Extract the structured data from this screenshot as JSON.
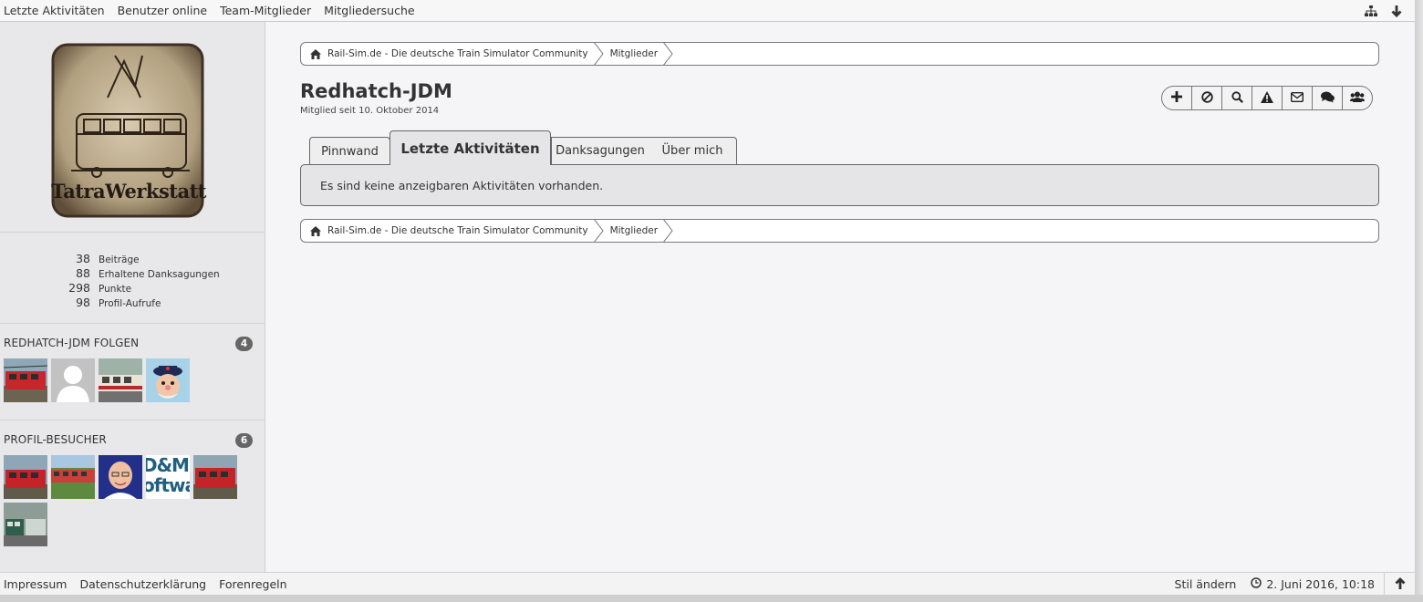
{
  "topbar": {
    "links": [
      "Letzte Aktivitäten",
      "Benutzer online",
      "Team-Mitglieder",
      "Mitgliedersuche"
    ],
    "icons": [
      "sitemap-icon",
      "arrow-down-icon"
    ]
  },
  "sidebar": {
    "avatar_text": "TatraWerkstatt",
    "stats": [
      {
        "value": "38",
        "label": "Beiträge"
      },
      {
        "value": "88",
        "label": "Erhaltene Danksagungen"
      },
      {
        "value": "298",
        "label": "Punkte"
      },
      {
        "value": "98",
        "label": "Profil-Aufrufe"
      }
    ],
    "following": {
      "heading": "REDHATCH-JDM FOLGEN",
      "count": "4"
    },
    "visitors": {
      "heading": "PROFIL-BESUCHER",
      "count": "6",
      "thumb_text": "D&M oftwar"
    }
  },
  "breadcrumb": {
    "home": "Rail-Sim.de - Die deutsche Train Simulator Community",
    "current": "Mitglieder"
  },
  "profile": {
    "name": "Redhatch-JDM",
    "member_since": "Mitglied seit 10. Oktober 2014"
  },
  "actions": [
    "plus-icon",
    "ban-icon",
    "search-icon",
    "warning-icon",
    "envelope-icon",
    "comments-icon",
    "users-icon"
  ],
  "tabs": {
    "wall": "Pinnwand",
    "activity": "Letzte Aktivitäten",
    "thanks": "Danksagungen",
    "about": "Über mich"
  },
  "content": {
    "empty_message": "Es sind keine anzeigbaren Aktivitäten vorhanden."
  },
  "footer": {
    "links": [
      "Impressum",
      "Datenschutzerklärung",
      "Forenregeln"
    ],
    "style": "Stil ändern",
    "datetime": "2. Juni 2016, 10:18"
  }
}
